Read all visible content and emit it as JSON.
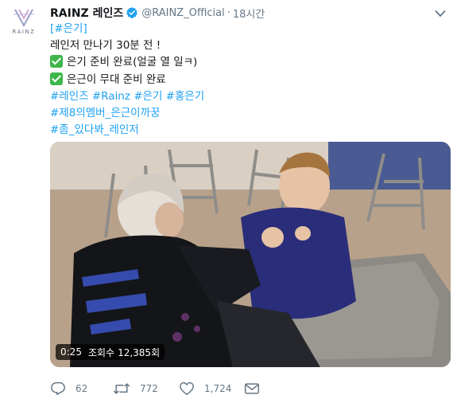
{
  "account": {
    "display_name": "RAINZ 레인즈",
    "handle": "@RAINZ_Official",
    "separator": "·",
    "time": "18시간",
    "avatar_logo_text": "RAINZ",
    "verified_icon": "verified-badge-icon"
  },
  "tweet": {
    "lines": [
      {
        "type": "hashtag_bracket",
        "open": "[",
        "tag": "#은기",
        "close": "]"
      },
      {
        "type": "text",
        "text": "레인저 만나기 30분 전 !"
      },
      {
        "type": "check",
        "text": "은기 준비 완료(얼굴 열 일ㅋ)"
      },
      {
        "type": "check",
        "text": "은근이 무대 준비 완료"
      },
      {
        "type": "hashtags",
        "text": "#레인즈 #Rainz #은기 #홍은기"
      },
      {
        "type": "hashtags",
        "text": "#제8의멤버_은근이까꿍"
      },
      {
        "type": "hashtags",
        "text": "#좀_있다봐_레인저"
      }
    ],
    "check_icon": "white-check-mark-icon"
  },
  "media": {
    "duration": "0:25",
    "views_label": "조회수",
    "views_count": "12,385회"
  },
  "actions": {
    "reply_count": "62",
    "retweet_count": "772",
    "like_count": "1,724"
  },
  "colors": {
    "link": "#1da1f2",
    "secondary": "#657786",
    "verified": "#1da1f2",
    "check": "#3eb64a"
  }
}
